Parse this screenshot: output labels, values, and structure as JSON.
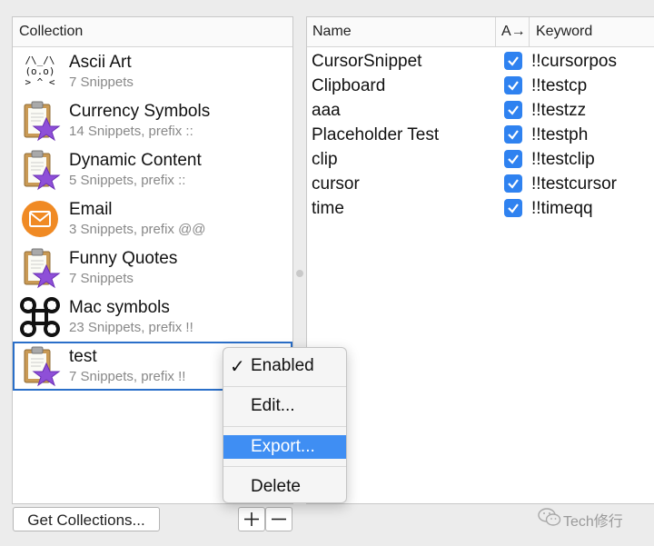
{
  "collection_panel": {
    "header": "Collection",
    "items": [
      {
        "title": "Ascii Art",
        "subtitle": "7 Snippets",
        "icon": "ascii-cat-icon"
      },
      {
        "title": "Currency Symbols",
        "subtitle": "14 Snippets, prefix ::",
        "icon": "clipboard-star-icon"
      },
      {
        "title": "Dynamic Content",
        "subtitle": "5 Snippets, prefix ::",
        "icon": "clipboard-star-icon"
      },
      {
        "title": "Email",
        "subtitle": "3 Snippets, prefix @@",
        "icon": "envelope-icon"
      },
      {
        "title": "Funny Quotes",
        "subtitle": "7 Snippets",
        "icon": "clipboard-star-icon"
      },
      {
        "title": "Mac symbols",
        "subtitle": "23 Snippets, prefix !!",
        "icon": "command-key-icon"
      },
      {
        "title": "test",
        "subtitle": "7 Snippets, prefix !!",
        "icon": "clipboard-star-icon",
        "selected": true
      }
    ],
    "ascii_art": {
      "line1": "/\\_/\\",
      "line2": "(o.o)",
      "line3": "> ^ <"
    }
  },
  "snippet_table": {
    "columns": {
      "name": "Name",
      "auto": "A→",
      "keyword": "Keyword"
    },
    "rows": [
      {
        "name": "CursorSnippet",
        "checked": true,
        "keyword": "!!cursorpos"
      },
      {
        "name": "Clipboard",
        "checked": true,
        "keyword": "!!testcp"
      },
      {
        "name": "aaa",
        "checked": true,
        "keyword": "!!testzz"
      },
      {
        "name": "Placeholder Test",
        "checked": true,
        "keyword": "!!testph"
      },
      {
        "name": "clip",
        "checked": true,
        "keyword": "!!testclip"
      },
      {
        "name": "cursor",
        "checked": true,
        "keyword": "!!testcursor"
      },
      {
        "name": "time",
        "checked": true,
        "keyword": "!!timeqq"
      }
    ]
  },
  "buttons": {
    "get_collections": "Get Collections...",
    "add": "+",
    "remove": "−"
  },
  "context_menu": {
    "items": [
      {
        "label": "Enabled",
        "checked": true
      },
      {
        "label": "Edit..."
      },
      {
        "label": "Export...",
        "highlighted": true
      },
      {
        "label": "Delete"
      }
    ],
    "check_glyph": "✓"
  },
  "watermark": {
    "text": "Tech修行"
  },
  "colors": {
    "accent": "#2f82f0",
    "selection_border": "#2a6fc9",
    "menu_highlight": "#3f8ef3",
    "email_orange": "#f08a24",
    "star_purple": "#8e4fd8"
  }
}
